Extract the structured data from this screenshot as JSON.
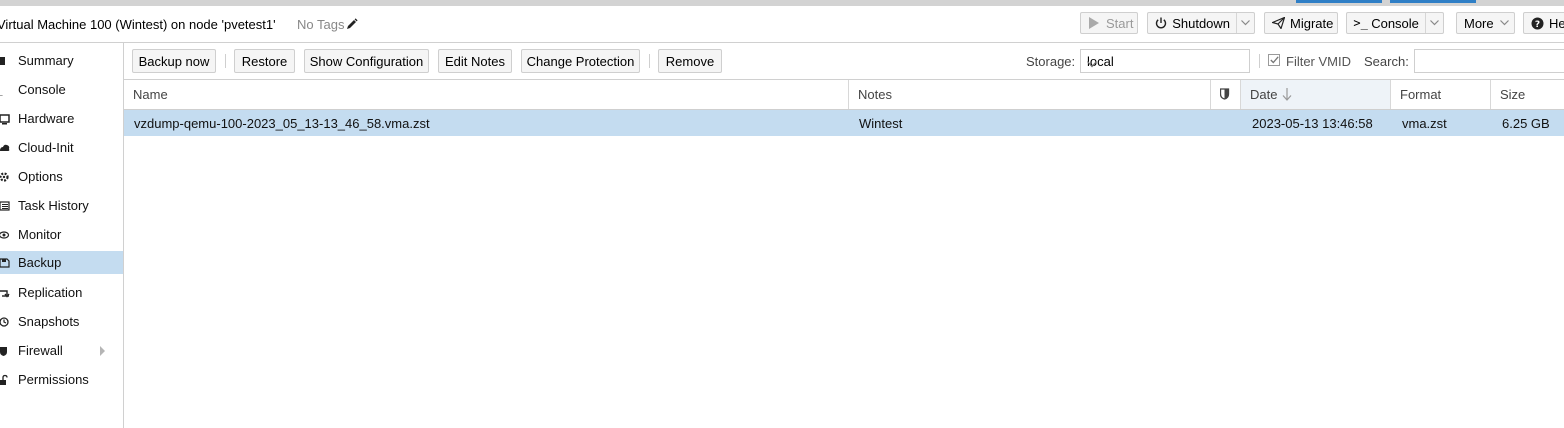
{
  "header": {
    "title": "Virtual Machine 100 (Wintest) on node 'pvetest1'",
    "tags_label": "No Tags",
    "buttons": {
      "start": "Start",
      "shutdown": "Shutdown",
      "migrate": "Migrate",
      "console": "Console",
      "more": "More",
      "help": "He"
    }
  },
  "sidebar": {
    "items": [
      {
        "label": "Summary",
        "icon": "summary-icon"
      },
      {
        "label": "Console",
        "icon": "console-icon"
      },
      {
        "label": "Hardware",
        "icon": "hardware-icon"
      },
      {
        "label": "Cloud-Init",
        "icon": "cloud-icon"
      },
      {
        "label": "Options",
        "icon": "gear-icon"
      },
      {
        "label": "Task History",
        "icon": "list-icon"
      },
      {
        "label": "Monitor",
        "icon": "eye-icon"
      },
      {
        "label": "Backup",
        "icon": "floppy-icon"
      },
      {
        "label": "Replication",
        "icon": "retweet-icon"
      },
      {
        "label": "Snapshots",
        "icon": "history-icon"
      },
      {
        "label": "Firewall",
        "icon": "shield-icon"
      },
      {
        "label": "Permissions",
        "icon": "unlock-icon"
      }
    ],
    "active": "Backup"
  },
  "toolbar": {
    "backup_now": "Backup now",
    "restore": "Restore",
    "show_configuration": "Show Configuration",
    "edit_notes": "Edit Notes",
    "change_protection": "Change Protection",
    "remove": "Remove",
    "storage_label": "Storage:",
    "storage_value": "local",
    "filter_vmid": "Filter VMID",
    "filter_checked": true,
    "search_label": "Search:",
    "search_value": ""
  },
  "grid": {
    "columns": {
      "name": "Name",
      "notes": "Notes",
      "date": "Date",
      "format": "Format",
      "size": "Size"
    },
    "rows": [
      {
        "name": "vzdump-qemu-100-2023_05_13-13_46_58.vma.zst",
        "notes": "Wintest",
        "date": "2023-05-13 13:46:58",
        "format": "vma.zst",
        "size": "6.25 GB"
      }
    ]
  },
  "colors": {
    "selection": "#c4dcf0",
    "accent": "#2f7fc6"
  }
}
